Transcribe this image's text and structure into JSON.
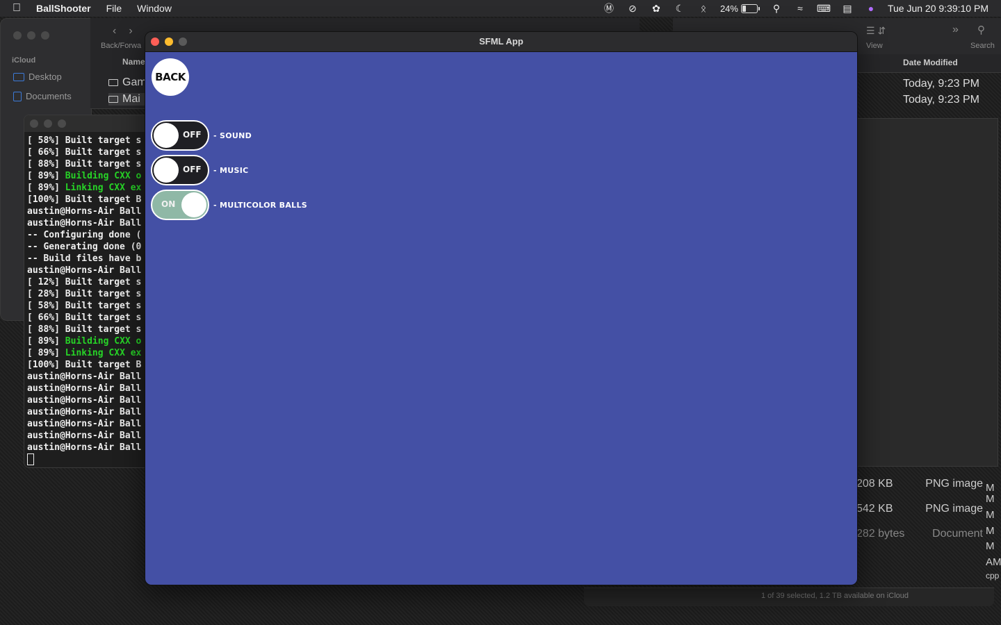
{
  "menubar": {
    "app_name": "BallShooter",
    "menus": [
      "File",
      "Window"
    ],
    "battery_percent": "24%",
    "battery_level": 0.24,
    "clock": "Tue Jun 20  9:39:10 PM"
  },
  "finder": {
    "sidebar_heading": "iCloud",
    "sidebar_items": [
      "Desktop",
      "Documents"
    ],
    "toolbar_label": "Back/Forwa",
    "column_name": "Name",
    "rows": [
      "Gam",
      "Mai"
    ],
    "view_label": "View",
    "search_label": "Search",
    "column_date": "Date Modified",
    "dates": [
      "Today, 9:23 PM",
      "Today, 9:23 PM"
    ],
    "files": [
      {
        "size": "208 KB",
        "kind": "PNG image"
      },
      {
        "size": "542 KB",
        "kind": "PNG image"
      },
      {
        "size": "282 bytes",
        "kind": "Document"
      }
    ],
    "edge_letters": [
      "M",
      "M",
      "M",
      "M",
      "M",
      "AM",
      "cpp"
    ],
    "status": "1 of 39 selected, 1.2 TB available on iCloud"
  },
  "terminal": {
    "lines": [
      {
        "text": "[ 58%] Built target s",
        "green": false
      },
      {
        "text": "[ 66%] Built target s",
        "green": false
      },
      {
        "text": "[ 88%] Built target s",
        "green": false
      },
      {
        "prefix": "[ 89%] ",
        "text": "Building CXX o",
        "green": true
      },
      {
        "prefix": "[ 89%] ",
        "text": "Linking CXX ex",
        "green": true
      },
      {
        "text": "[100%] Built target B",
        "green": false
      },
      {
        "text": "austin@Horns-Air Ball",
        "green": false
      },
      {
        "text": "austin@Horns-Air Ball",
        "green": false
      },
      {
        "text": "-- Configuring done (",
        "green": false
      },
      {
        "text": "-- Generating done (0",
        "green": false
      },
      {
        "text": "-- Build files have b",
        "green": false
      },
      {
        "text": "austin@Horns-Air Ball",
        "green": false
      },
      {
        "text": "[ 12%] Built target s",
        "green": false
      },
      {
        "text": "[ 28%] Built target s",
        "green": false
      },
      {
        "text": "[ 58%] Built target s",
        "green": false
      },
      {
        "text": "[ 66%] Built target s",
        "green": false
      },
      {
        "text": "[ 88%] Built target s",
        "green": false
      },
      {
        "prefix": "[ 89%] ",
        "text": "Building CXX o",
        "green": true
      },
      {
        "prefix": "[ 89%] ",
        "text": "Linking CXX ex",
        "green": true
      },
      {
        "text": "[100%] Built target B",
        "green": false
      },
      {
        "text": "austin@Horns-Air Ball",
        "green": false
      },
      {
        "text": "austin@Horns-Air Ball",
        "green": false
      },
      {
        "text": "austin@Horns-Air Ball",
        "green": false
      },
      {
        "text": "austin@Horns-Air Ball",
        "green": false
      },
      {
        "text": "austin@Horns-Air Ball",
        "green": false
      },
      {
        "text": "austin@Horns-Air Ball",
        "green": false
      },
      {
        "text": "austin@Horns-Air Ball",
        "green": false
      }
    ]
  },
  "sfml_window": {
    "title": "SFML App",
    "back_label": "BACK",
    "background_color": "#4450a5",
    "toggles": [
      {
        "state": "OFF",
        "on": false,
        "label": "- SOUND"
      },
      {
        "state": "OFF",
        "on": false,
        "label": "- MUSIC"
      },
      {
        "state": "ON",
        "on": true,
        "label": "- MULTICOLOR BALLS"
      }
    ]
  }
}
